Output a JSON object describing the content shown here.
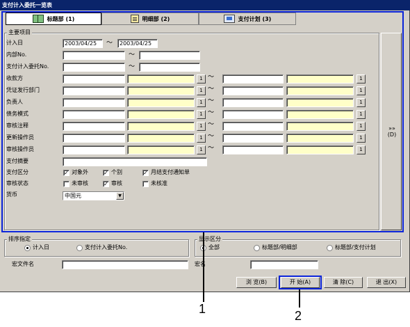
{
  "window": {
    "title": "支付计入委托一览表"
  },
  "tabs": [
    {
      "label": "标题部 (1)",
      "icon": "book-icon"
    },
    {
      "label": "明细部 (2)",
      "icon": "document-icon"
    },
    {
      "label": "支付计划 (3)",
      "icon": "plan-icon"
    }
  ],
  "main_group": {
    "title": "主要项目",
    "entry_date": {
      "label": "计入日",
      "from": "2003/04/25",
      "to": "2003/04/25",
      "sep": "～"
    },
    "internal_no": {
      "label": "内部No.",
      "sep": "～"
    },
    "payment_no": {
      "label": "支付计入委托No.",
      "sep": "～"
    },
    "range_rows": [
      {
        "label": "收款方",
        "btn": "1",
        "sep": "～"
      },
      {
        "label": "凭证发行部门",
        "btn": "1",
        "sep": "～"
      },
      {
        "label": "负责人",
        "btn": "1",
        "sep": "～"
      },
      {
        "label": "债务模式",
        "btn": "1",
        "sep": "～"
      },
      {
        "label": "审核注释",
        "btn": "1",
        "sep": "～"
      },
      {
        "label": "更新操作员",
        "btn": "1",
        "sep": "～"
      },
      {
        "label": "审核操作员",
        "btn": "1",
        "sep": "～"
      }
    ],
    "summary": {
      "label": "支付摘要"
    },
    "payment_type": {
      "label": "支付区分",
      "options": [
        {
          "label": "对象外",
          "checked": true
        },
        {
          "label": "个别",
          "checked": true
        },
        {
          "label": "月结支付通知单",
          "checked": true
        }
      ]
    },
    "review_status": {
      "label": "审核状态",
      "options": [
        {
          "label": "未审核",
          "checked": false
        },
        {
          "label": "审核",
          "checked": true
        },
        {
          "label": "未核准",
          "checked": false
        }
      ]
    },
    "currency": {
      "label": "货币",
      "value": "中国元"
    }
  },
  "side_button": {
    "label": "»» (D)"
  },
  "sort_group": {
    "title": "排序指定",
    "options": [
      {
        "label": "计入日",
        "selected": true
      },
      {
        "label": "支付计入委托No.",
        "selected": false
      }
    ]
  },
  "display_group": {
    "title": "显示区分",
    "options": [
      {
        "label": "全部",
        "selected": true
      },
      {
        "label": "标题部/明细部",
        "selected": false
      },
      {
        "label": "标题部/支付计划",
        "selected": false
      }
    ]
  },
  "macro": {
    "file_label": "宏文件名",
    "name_label": "宏名"
  },
  "buttons": {
    "browse": "浏 览(B)",
    "start": "开 始(A)",
    "clear": "清 除(C)",
    "exit": "退 出(X)"
  },
  "callouts": {
    "one": "1",
    "two": "2"
  },
  "colors": {
    "highlight": "#0a23d8",
    "title_bar": "#0a246a",
    "yellow_field": "#ffffc8"
  }
}
